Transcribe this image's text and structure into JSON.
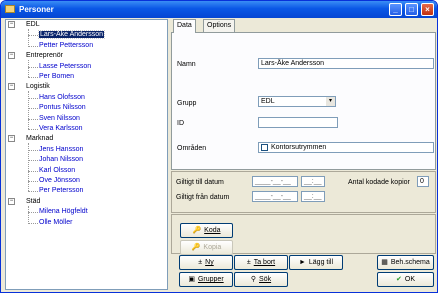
{
  "window": {
    "title": "Personer"
  },
  "tree": {
    "groups": [
      {
        "name": "EDL",
        "items": [
          "Lars-Åke Andersson",
          "Petter Pettersson"
        ]
      },
      {
        "name": "Entreprenör",
        "items": [
          "Lasse Petersson",
          "Per Bomen"
        ]
      },
      {
        "name": "Logistik",
        "items": [
          "Hans Olofsson",
          "Pontus Nilsson",
          "Sven Nilsson",
          "Vera Karlsson"
        ]
      },
      {
        "name": "Marknad",
        "items": [
          "Jens Hansson",
          "Johan Nilsson",
          "Karl Olsson",
          "Ove Jönsson",
          "Per Petersson"
        ]
      },
      {
        "name": "Städ",
        "items": [
          "Milena Högfeldt",
          "Olle Möller"
        ]
      }
    ],
    "selected": "Lars-Åke Andersson"
  },
  "tabs": [
    {
      "label": "Data"
    },
    {
      "label": "Options"
    }
  ],
  "form": {
    "namn_label": "Namn",
    "namn_value": "Lars-Åke Andersson",
    "grupp_label": "Grupp",
    "grupp_value": "EDL",
    "id_label": "ID",
    "id_value": "",
    "omraden_label": "Områden",
    "omraden_value": "Kontorsutrymmen"
  },
  "validity": {
    "giltig_till_label": "Giltigt till datum",
    "giltig_fran_label": "Giltigt från datum",
    "date_placeholder": "____-__-__",
    "time_placeholder": "__:__",
    "antal_label": "Antal kodade kopior",
    "antal_value": "0"
  },
  "code_buttons": {
    "koda": "Koda",
    "kopia": "Kopia"
  },
  "actions": {
    "ny": "Ny",
    "ta_bort": "Ta bort",
    "lagg_till": "Lägg till",
    "beh_schema": "Beh.schema",
    "grupper": "Grupper",
    "sok": "Sök",
    "ok": "OK"
  }
}
